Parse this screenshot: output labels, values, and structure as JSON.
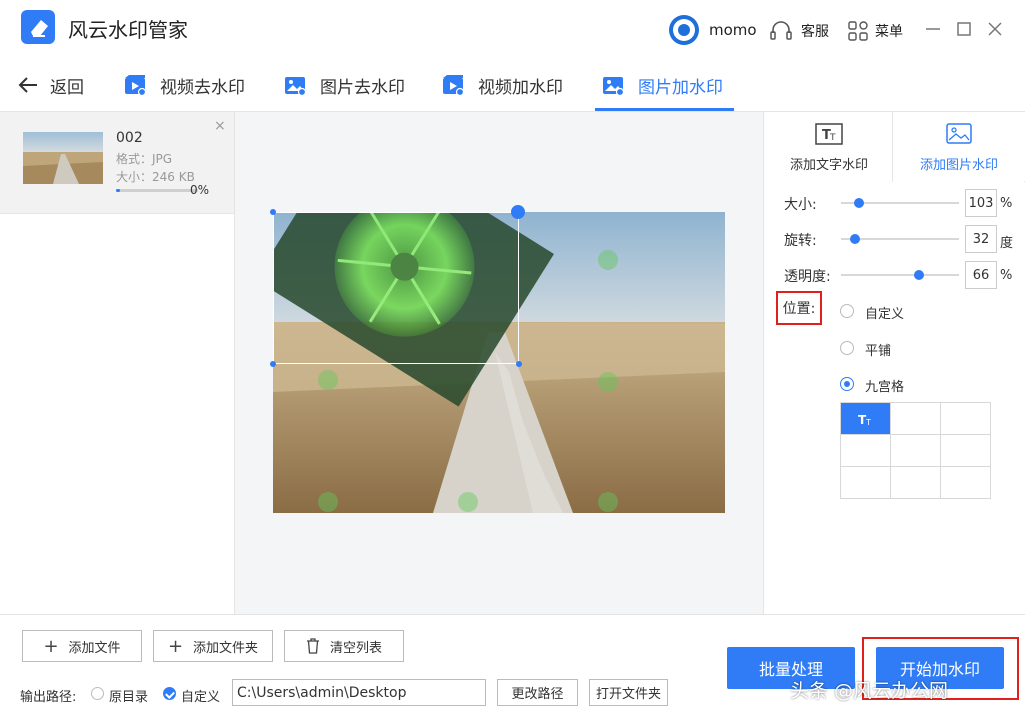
{
  "app": {
    "title": "风云水印管家"
  },
  "header": {
    "username": "momo",
    "service_label": "客服",
    "menu_label": "菜单"
  },
  "nav": {
    "back_label": "返回",
    "tabs": [
      {
        "label": "视频去水印",
        "icon": "video-icon"
      },
      {
        "label": "图片去水印",
        "icon": "image-icon"
      },
      {
        "label": "视频加水印",
        "icon": "video-icon"
      },
      {
        "label": "图片加水印",
        "icon": "image-icon",
        "active": true
      }
    ]
  },
  "file": {
    "name": "002",
    "format": "格式：JPG",
    "size": "大小：246 KB",
    "progress": "0%",
    "progress_value": 0.05
  },
  "watermark": {
    "tabs": [
      {
        "label": "添加文字水印",
        "icon": "text-watermark-icon"
      },
      {
        "label": "添加图片水印",
        "icon": "image-watermark-icon",
        "active": true
      }
    ],
    "size": {
      "label": "大小:",
      "value": "103",
      "unit": "%",
      "fraction": 0.15
    },
    "rotate": {
      "label": "旋转:",
      "value": "32",
      "unit": "度",
      "fraction": 0.12
    },
    "opacity": {
      "label": "透明度:",
      "value": "66",
      "unit": "%",
      "fraction": 0.66
    },
    "position": {
      "label": "位置:",
      "options": [
        "自定义",
        "平铺",
        "九宫格"
      ],
      "selected": "九宫格",
      "grid_selected": 0
    }
  },
  "bottom": {
    "add_file": "添加文件",
    "add_folder": "添加文件夹",
    "clear_list": "清空列表",
    "output_label": "输出路径:",
    "output_original": "原目录",
    "output_custom": "自定义",
    "output_path": "C:\\Users\\admin\\Desktop",
    "change_path": "更改路径",
    "open_folder": "打开文件夹",
    "batch": "批量处理",
    "start": "开始加水印"
  },
  "overlay": {
    "brand": "头条 @风云办公网"
  },
  "colors": {
    "accent": "#2f7cf6",
    "highlight": "#e0201c"
  }
}
